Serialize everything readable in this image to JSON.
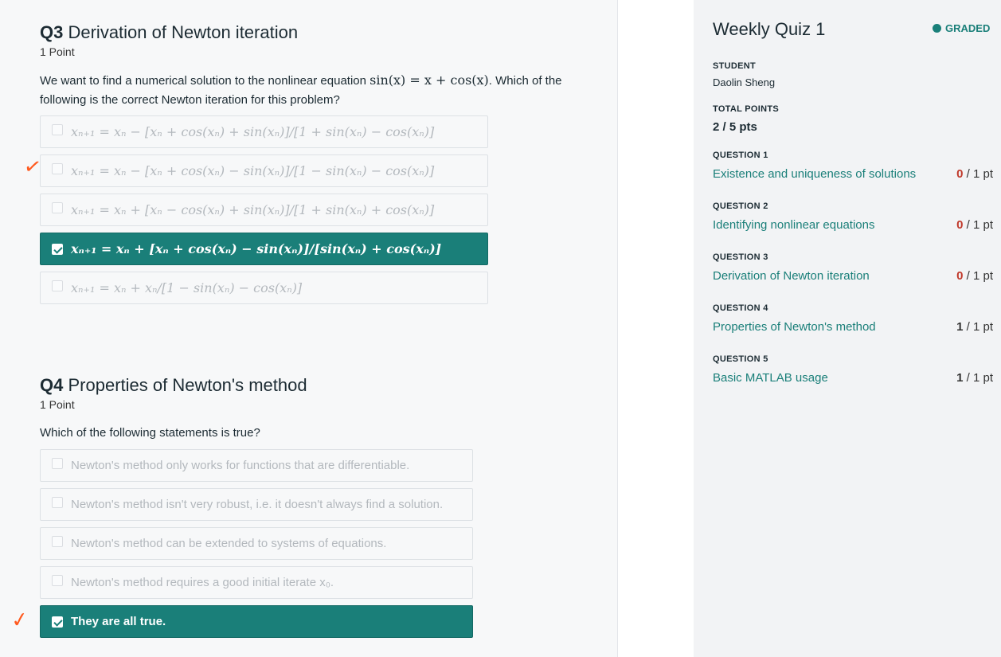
{
  "q3": {
    "number": "Q3",
    "title": "Derivation of Newton iteration",
    "points": "1 Point",
    "prompt_before": "We want to find a numerical solution to the nonlinear equation ",
    "prompt_math": "sin(x) = x + cos(x)",
    "prompt_after": ". Which of the following is the correct Newton iteration for this problem?",
    "options": [
      "xₙ₊₁ = xₙ − [xₙ + cos(xₙ) + sin(xₙ)]/[1 + sin(xₙ) − cos(xₙ)]",
      "xₙ₊₁ = xₙ − [xₙ + cos(xₙ) − sin(xₙ)]/[1 − sin(xₙ) − cos(xₙ)]",
      "xₙ₊₁ = xₙ + [xₙ − cos(xₙ) + sin(xₙ)]/[1 + sin(xₙ) + cos(xₙ)]",
      "xₙ₊₁ = xₙ + [xₙ + cos(xₙ) − sin(xₙ)]/[sin(xₙ) + cos(xₙ)]",
      "xₙ₊₁ = xₙ + xₙ/[1 − sin(xₙ) − cos(xₙ)]"
    ],
    "selected_index": 3
  },
  "q4": {
    "number": "Q4",
    "title": "Properties of Newton's method",
    "points": "1 Point",
    "prompt": "Which of the following statements is true?",
    "options": [
      "Newton's method only works for functions that are differentiable.",
      "Newton's method isn't very robust, i.e. it doesn't always find a solution.",
      "Newton's method can be extended to systems of equations.",
      "Newton's method requires a good initial iterate x₀.",
      "They are all true."
    ],
    "selected_index": 4
  },
  "annotations": {
    "q3_mark": "✓",
    "q4_mark": "✓",
    "mark_color": "#ff5a1f"
  },
  "sidebar": {
    "quiz_title": "Weekly Quiz 1",
    "status": "GRADED",
    "student_label": "STUDENT",
    "student_name": "Daolin Sheng",
    "total_label": "TOTAL POINTS",
    "total_value": "2 / 5 pts",
    "questions": [
      {
        "label": "QUESTION 1",
        "title": "Existence and uniqueness of solutions",
        "earned": "0",
        "max": " / 1 pt"
      },
      {
        "label": "QUESTION 2",
        "title": "Identifying nonlinear equations",
        "earned": "0",
        "max": " / 1 pt"
      },
      {
        "label": "QUESTION 3",
        "title": "Derivation of Newton iteration",
        "earned": "0",
        "max": " / 1 pt"
      },
      {
        "label": "QUESTION 4",
        "title": "Properties of Newton's method",
        "earned": "1",
        "max": " / 1 pt"
      },
      {
        "label": "QUESTION 5",
        "title": "Basic MATLAB usage",
        "earned": "1",
        "max": " / 1 pt"
      }
    ]
  },
  "colors": {
    "accent": "#1a7f79",
    "zero_score": "#c0392b"
  }
}
